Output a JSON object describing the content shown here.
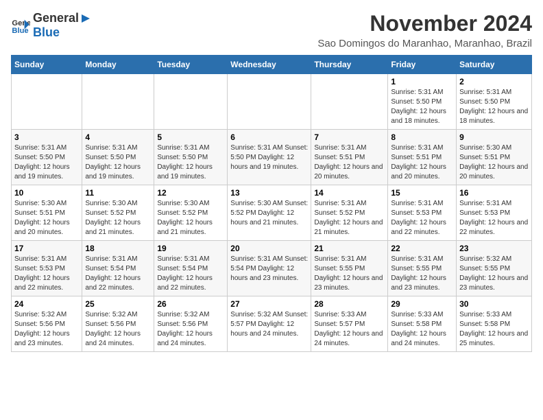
{
  "logo": {
    "general": "General",
    "blue": "Blue"
  },
  "title": "November 2024",
  "subtitle": "Sao Domingos do Maranhao, Maranhao, Brazil",
  "days_of_week": [
    "Sunday",
    "Monday",
    "Tuesday",
    "Wednesday",
    "Thursday",
    "Friday",
    "Saturday"
  ],
  "weeks": [
    [
      {
        "day": "",
        "info": ""
      },
      {
        "day": "",
        "info": ""
      },
      {
        "day": "",
        "info": ""
      },
      {
        "day": "",
        "info": ""
      },
      {
        "day": "",
        "info": ""
      },
      {
        "day": "1",
        "info": "Sunrise: 5:31 AM\nSunset: 5:50 PM\nDaylight: 12 hours\nand 18 minutes."
      },
      {
        "day": "2",
        "info": "Sunrise: 5:31 AM\nSunset: 5:50 PM\nDaylight: 12 hours\nand 18 minutes."
      }
    ],
    [
      {
        "day": "3",
        "info": "Sunrise: 5:31 AM\nSunset: 5:50 PM\nDaylight: 12 hours\nand 19 minutes."
      },
      {
        "day": "4",
        "info": "Sunrise: 5:31 AM\nSunset: 5:50 PM\nDaylight: 12 hours\nand 19 minutes."
      },
      {
        "day": "5",
        "info": "Sunrise: 5:31 AM\nSunset: 5:50 PM\nDaylight: 12 hours\nand 19 minutes."
      },
      {
        "day": "6",
        "info": "Sunrise: 5:31 AM\nSunset: 5:50 PM\nDaylight: 12 hours\nand 19 minutes."
      },
      {
        "day": "7",
        "info": "Sunrise: 5:31 AM\nSunset: 5:51 PM\nDaylight: 12 hours\nand 20 minutes."
      },
      {
        "day": "8",
        "info": "Sunrise: 5:31 AM\nSunset: 5:51 PM\nDaylight: 12 hours\nand 20 minutes."
      },
      {
        "day": "9",
        "info": "Sunrise: 5:30 AM\nSunset: 5:51 PM\nDaylight: 12 hours\nand 20 minutes."
      }
    ],
    [
      {
        "day": "10",
        "info": "Sunrise: 5:30 AM\nSunset: 5:51 PM\nDaylight: 12 hours\nand 20 minutes."
      },
      {
        "day": "11",
        "info": "Sunrise: 5:30 AM\nSunset: 5:52 PM\nDaylight: 12 hours\nand 21 minutes."
      },
      {
        "day": "12",
        "info": "Sunrise: 5:30 AM\nSunset: 5:52 PM\nDaylight: 12 hours\nand 21 minutes."
      },
      {
        "day": "13",
        "info": "Sunrise: 5:30 AM\nSunset: 5:52 PM\nDaylight: 12 hours\nand 21 minutes."
      },
      {
        "day": "14",
        "info": "Sunrise: 5:31 AM\nSunset: 5:52 PM\nDaylight: 12 hours\nand 21 minutes."
      },
      {
        "day": "15",
        "info": "Sunrise: 5:31 AM\nSunset: 5:53 PM\nDaylight: 12 hours\nand 22 minutes."
      },
      {
        "day": "16",
        "info": "Sunrise: 5:31 AM\nSunset: 5:53 PM\nDaylight: 12 hours\nand 22 minutes."
      }
    ],
    [
      {
        "day": "17",
        "info": "Sunrise: 5:31 AM\nSunset: 5:53 PM\nDaylight: 12 hours\nand 22 minutes."
      },
      {
        "day": "18",
        "info": "Sunrise: 5:31 AM\nSunset: 5:54 PM\nDaylight: 12 hours\nand 22 minutes."
      },
      {
        "day": "19",
        "info": "Sunrise: 5:31 AM\nSunset: 5:54 PM\nDaylight: 12 hours\nand 22 minutes."
      },
      {
        "day": "20",
        "info": "Sunrise: 5:31 AM\nSunset: 5:54 PM\nDaylight: 12 hours\nand 23 minutes."
      },
      {
        "day": "21",
        "info": "Sunrise: 5:31 AM\nSunset: 5:55 PM\nDaylight: 12 hours\nand 23 minutes."
      },
      {
        "day": "22",
        "info": "Sunrise: 5:31 AM\nSunset: 5:55 PM\nDaylight: 12 hours\nand 23 minutes."
      },
      {
        "day": "23",
        "info": "Sunrise: 5:32 AM\nSunset: 5:55 PM\nDaylight: 12 hours\nand 23 minutes."
      }
    ],
    [
      {
        "day": "24",
        "info": "Sunrise: 5:32 AM\nSunset: 5:56 PM\nDaylight: 12 hours\nand 23 minutes."
      },
      {
        "day": "25",
        "info": "Sunrise: 5:32 AM\nSunset: 5:56 PM\nDaylight: 12 hours\nand 24 minutes."
      },
      {
        "day": "26",
        "info": "Sunrise: 5:32 AM\nSunset: 5:56 PM\nDaylight: 12 hours\nand 24 minutes."
      },
      {
        "day": "27",
        "info": "Sunrise: 5:32 AM\nSunset: 5:57 PM\nDaylight: 12 hours\nand 24 minutes."
      },
      {
        "day": "28",
        "info": "Sunrise: 5:33 AM\nSunset: 5:57 PM\nDaylight: 12 hours\nand 24 minutes."
      },
      {
        "day": "29",
        "info": "Sunrise: 5:33 AM\nSunset: 5:58 PM\nDaylight: 12 hours\nand 24 minutes."
      },
      {
        "day": "30",
        "info": "Sunrise: 5:33 AM\nSunset: 5:58 PM\nDaylight: 12 hours\nand 25 minutes."
      }
    ]
  ]
}
